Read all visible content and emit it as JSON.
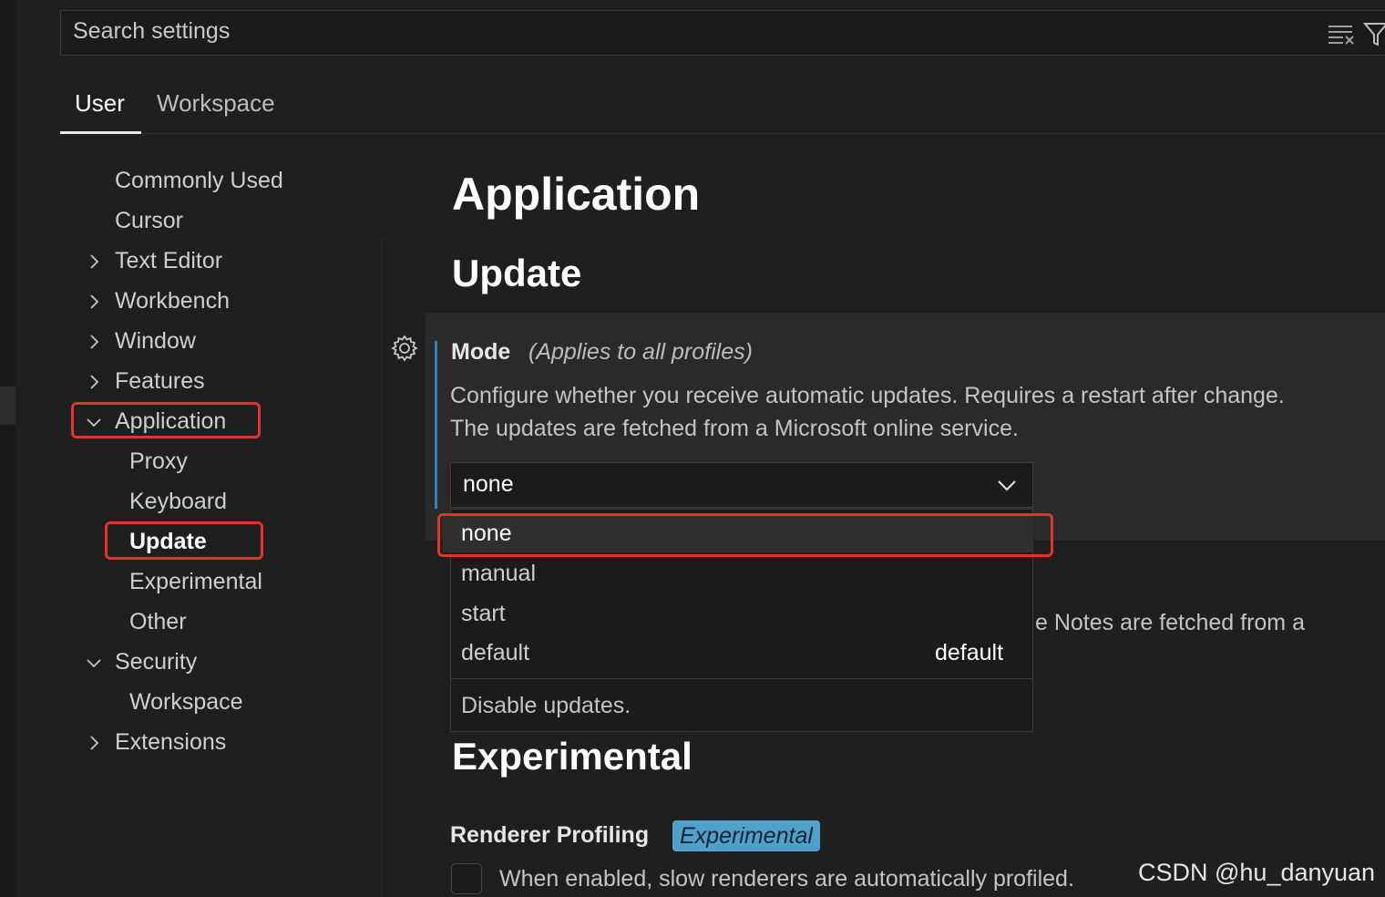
{
  "search": {
    "placeholder": "Search settings"
  },
  "tabs": [
    {
      "label": "User",
      "active": true
    },
    {
      "label": "Workspace",
      "active": false
    }
  ],
  "toc": {
    "items": [
      {
        "label": "Commonly Used"
      },
      {
        "label": "Cursor"
      },
      {
        "label": "Text Editor"
      },
      {
        "label": "Workbench"
      },
      {
        "label": "Window"
      },
      {
        "label": "Features"
      },
      {
        "label": "Application"
      },
      {
        "label": "Proxy"
      },
      {
        "label": "Keyboard"
      },
      {
        "label": "Update"
      },
      {
        "label": "Experimental"
      },
      {
        "label": "Other"
      },
      {
        "label": "Security"
      },
      {
        "label": "Workspace"
      },
      {
        "label": "Extensions"
      }
    ]
  },
  "content": {
    "section_title": "Application",
    "subsection_title": "Update",
    "mode_setting": {
      "title": "Mode",
      "scope": "(Applies to all profiles)",
      "description_line1": "Configure whether you receive automatic updates. Requires a restart after change.",
      "description_line2": "The updates are fetched from a Microsoft online service.",
      "selected_value": "none",
      "options": [
        {
          "label": "none"
        },
        {
          "label": "manual"
        },
        {
          "label": "start"
        },
        {
          "label": "default",
          "tag": "default"
        }
      ],
      "option_description": "Disable updates."
    },
    "behind_text": "e Notes are fetched from a",
    "experimental_title": "Experimental",
    "renderer_profiling": {
      "title": "Renderer Profiling",
      "tag": "Experimental",
      "description": "When enabled, slow renderers are automatically profiled."
    }
  },
  "watermark": "CSDN @hu_danyuan",
  "colors": {
    "accent_blue": "#2a82c8",
    "highlight_red": "#e5332b",
    "experimental_tag": "#4fa1c9"
  }
}
